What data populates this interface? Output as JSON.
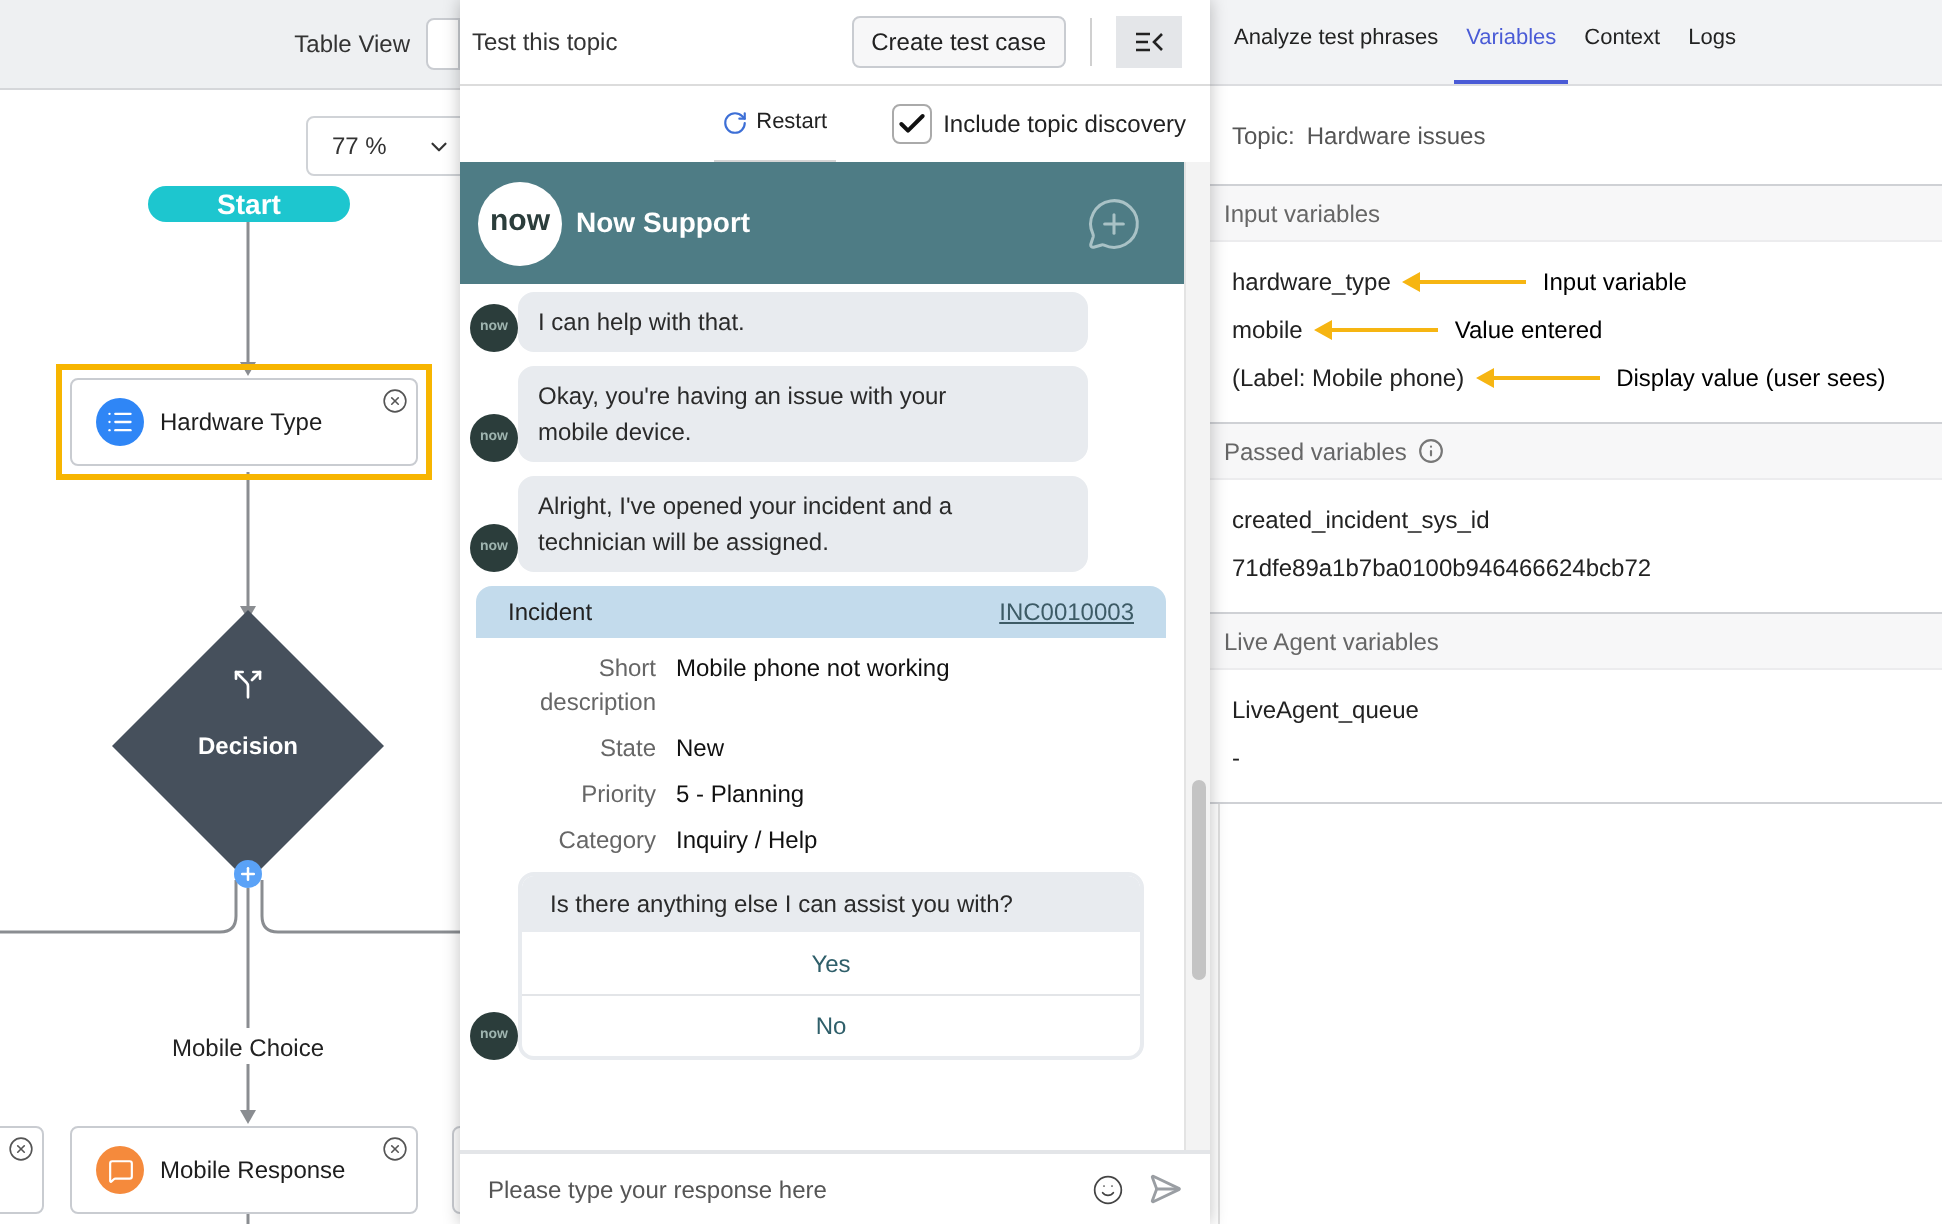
{
  "canvas": {
    "view_label": "Table View",
    "zoom": "77 %",
    "start": "Start",
    "decision": "Decision",
    "branch_label": "Mobile Choice",
    "nodes": [
      {
        "kind": "list",
        "label": "Hardware Type",
        "selected": true
      },
      {
        "kind": "response",
        "label": "Mobile Response",
        "selected": false
      }
    ]
  },
  "test_panel": {
    "title": "Test this topic",
    "create_button": "Create test case",
    "restart": "Restart",
    "discovery": {
      "label": "Include topic discovery",
      "checked": true
    }
  },
  "chat": {
    "logo": "now",
    "title": "Now Support",
    "messages": [
      {
        "text": "I can help with that.",
        "avatar": "now"
      },
      {
        "text": "Okay, you're having an issue with your mobile device.",
        "avatar": "now"
      },
      {
        "text": "Alright, I've opened your incident and a technician will be assigned.",
        "avatar": "now"
      }
    ],
    "incident": {
      "title": "Incident",
      "number": "INC0010003",
      "fields": [
        {
          "label": "Short description",
          "value": "Mobile phone not working"
        },
        {
          "label": "State",
          "value": "New"
        },
        {
          "label": "Priority",
          "value": "5 - Planning"
        },
        {
          "label": "Category",
          "value": "Inquiry / Help"
        }
      ]
    },
    "question": {
      "text": "Is there anything else I can assist you with?",
      "avatar": "now",
      "options": [
        "Yes",
        "No"
      ]
    },
    "input_placeholder": "Please type your response here"
  },
  "variables_panel": {
    "tabs": [
      {
        "label": "Analyze test phrases",
        "selected": false
      },
      {
        "label": "Variables",
        "selected": true
      },
      {
        "label": "Context",
        "selected": false
      },
      {
        "label": "Logs",
        "selected": false
      }
    ],
    "topic_label": "Topic:",
    "topic": "Hardware issues",
    "sections": [
      {
        "title": "Input variables",
        "info": false,
        "items": [
          {
            "text": "hardware_type",
            "annotation": "Input variable"
          },
          {
            "text": "mobile",
            "annotation": "Value entered"
          },
          {
            "text": "(Label: Mobile phone)",
            "annotation": "Display value (user sees)"
          }
        ]
      },
      {
        "title": "Passed variables",
        "info": true,
        "items": [
          {
            "text": "created_incident_sys_id"
          },
          {
            "text": "71dfe89a1b7ba0100b946466624bcb72"
          }
        ]
      },
      {
        "title": "Live Agent variables",
        "info": false,
        "items": [
          {
            "text": "LiveAgent_queue"
          },
          {
            "text": "-"
          }
        ]
      }
    ]
  }
}
